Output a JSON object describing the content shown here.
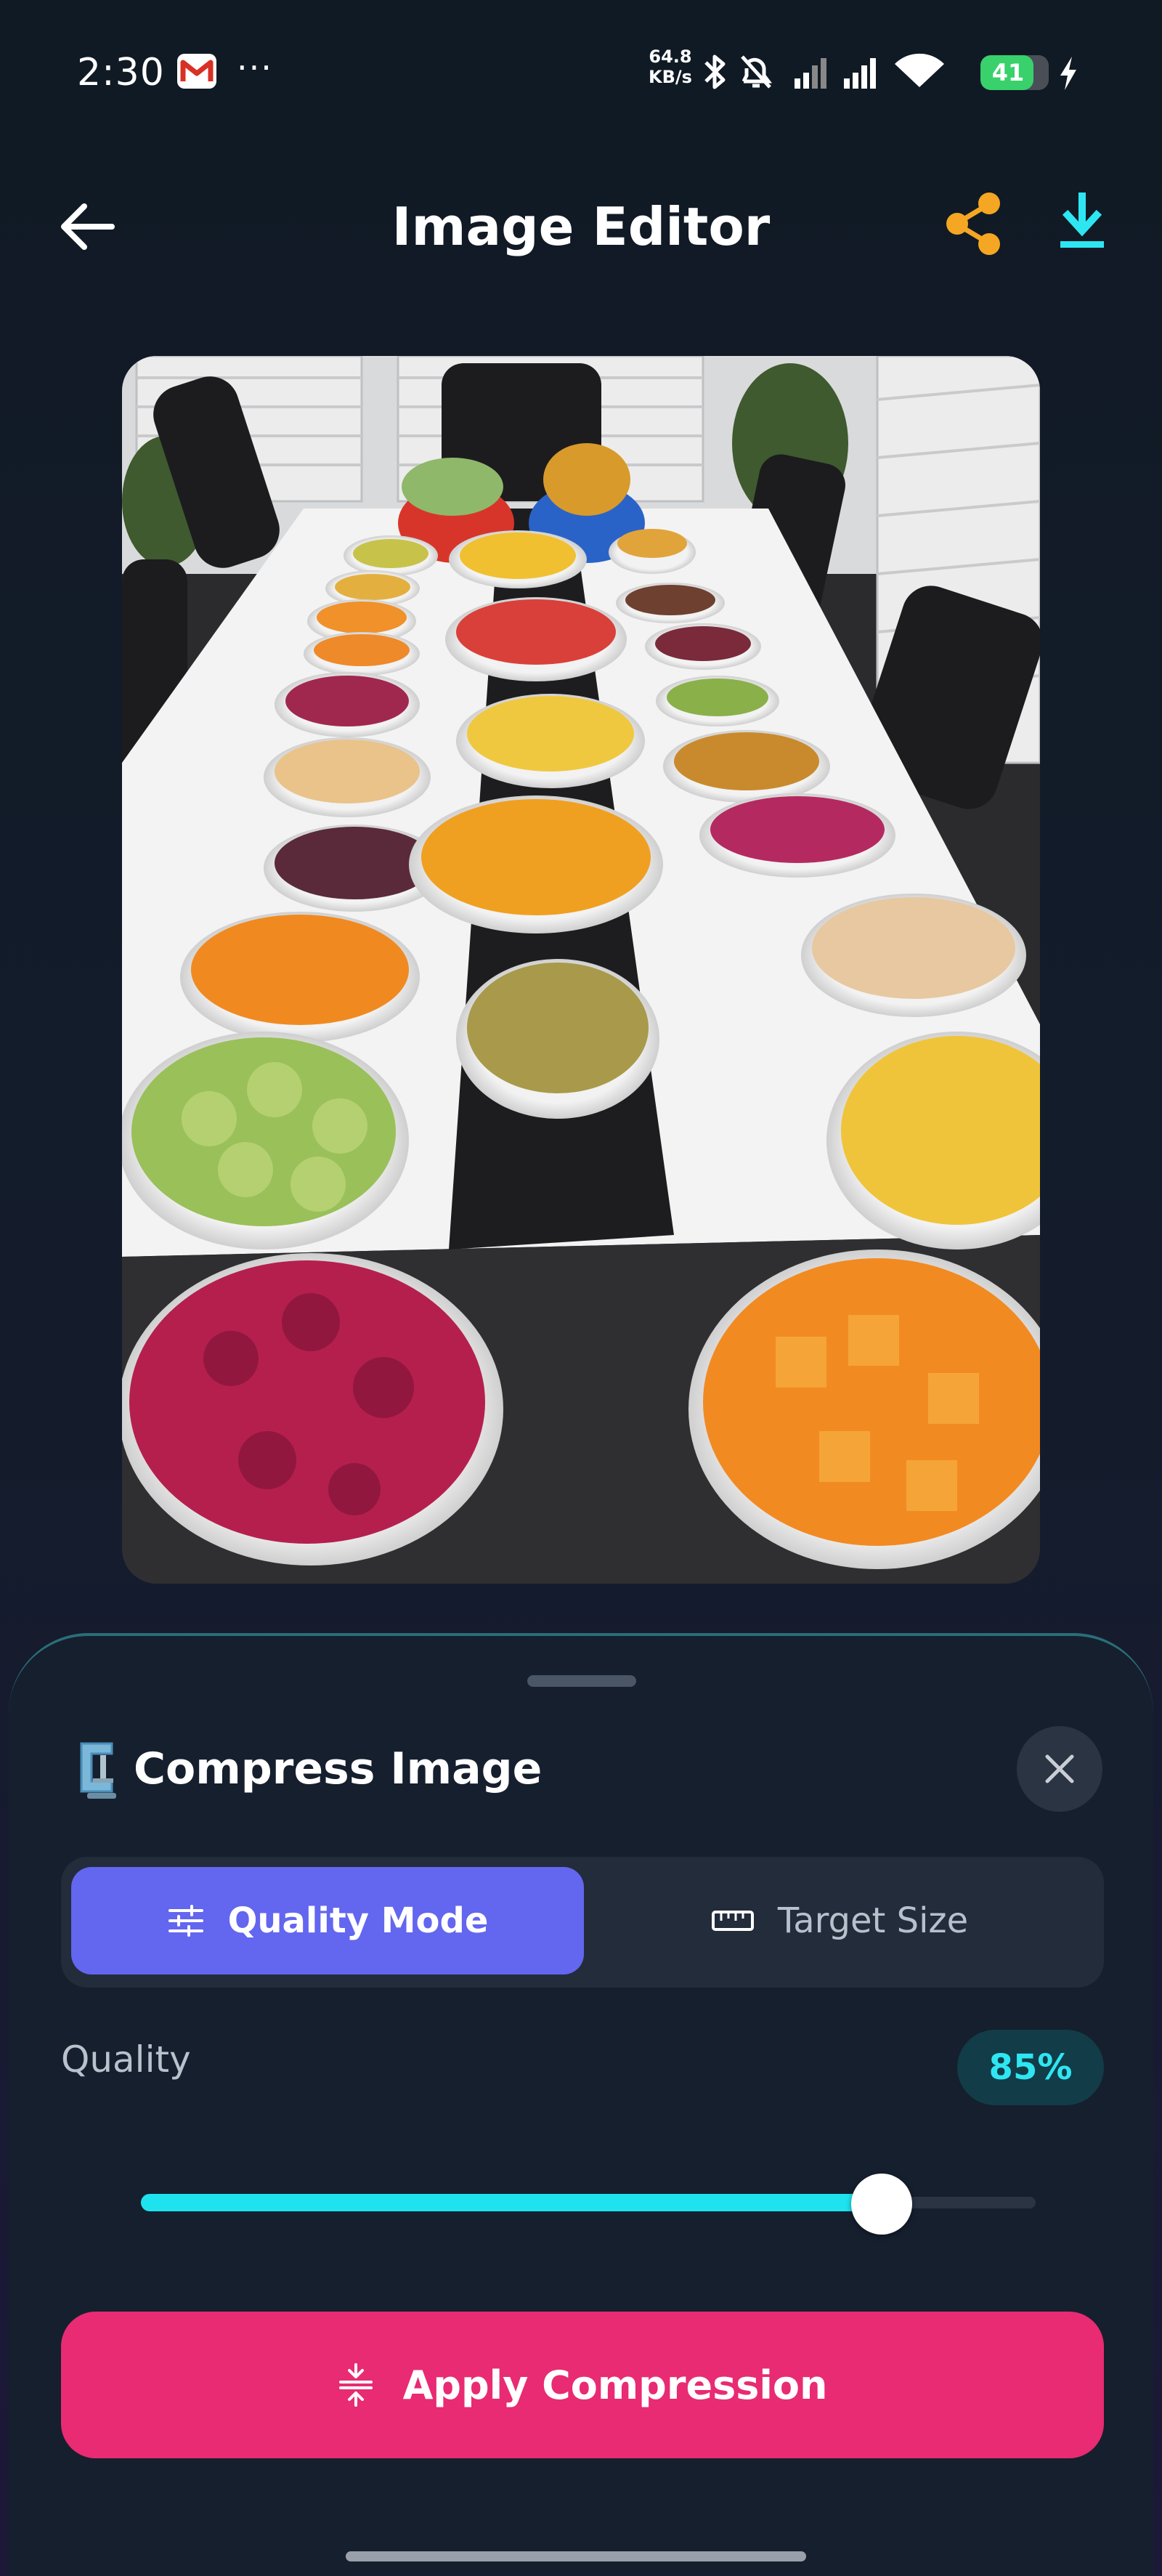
{
  "status_bar": {
    "time": "2:30",
    "more": "···",
    "net_speed_value": "64.8",
    "net_speed_unit": "KB/s",
    "battery": "41",
    "battery_level": 0.41,
    "icons": [
      "gmail-icon",
      "bluetooth-icon",
      "mute-icon",
      "signal-icon",
      "signal-icon",
      "wifi-icon",
      "charging-icon"
    ]
  },
  "header": {
    "title": "Image Editor"
  },
  "sheet": {
    "title": "Compress Image",
    "tabs": [
      {
        "label": "Quality Mode",
        "active": true
      },
      {
        "label": "Target Size",
        "active": false
      }
    ],
    "quality": {
      "label": "Quality",
      "value_text": "85%",
      "value": 0.85
    },
    "apply_label": "Apply Compression"
  },
  "colors": {
    "accent": "#6366ef",
    "cta": "#e82b72",
    "slider": "#1ee3ef",
    "share": "#f5a623",
    "download": "#2ee6f2"
  }
}
